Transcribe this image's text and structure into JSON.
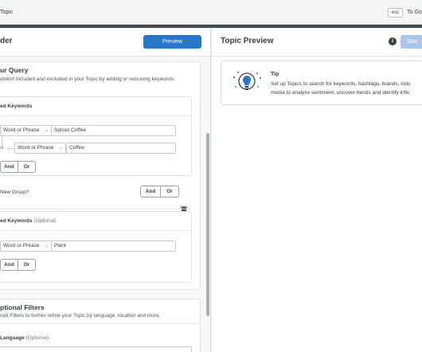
{
  "topbar": {
    "title": "Topic",
    "esc_label": "esc",
    "esc_text": "To Go"
  },
  "builder": {
    "title": "der",
    "preview_button": "Preview",
    "query": {
      "title": "ur Query",
      "description": "ontent included and excluded in your Topic by adding or removing keywords.",
      "included": {
        "label": "ed Keywords",
        "row1_type": "Word or Phrase",
        "row1_value": "Sprout Coffee",
        "row2_connector": "ot",
        "row2_type": "Word or Phrase",
        "row2_value": "Coffee",
        "and_label": "And",
        "or_label": "Or"
      },
      "new_group": {
        "label": "New Group?",
        "and_label": "And",
        "or_label": "Or"
      },
      "excluded": {
        "label": "ed Keywords",
        "optional": "(Optional)",
        "row1_type": "Word or Phrase",
        "row1_value": "Plant",
        "and_label": "And",
        "or_label": "Or"
      }
    },
    "filters": {
      "title": "ptional Filters",
      "description": "ced Filters to further refine your Topic by language, location and more.",
      "language_label": "Language",
      "language_optional": "(Optional)"
    }
  },
  "preview": {
    "title": "Topic Preview",
    "start_button": "Star",
    "tip": {
      "title": "Tip",
      "line1": "Set up Topics to search for keywords, hashtags, brands, indu",
      "line2": "media to analyze sentiment, uncover trends and identify influ"
    }
  },
  "icons": {
    "info": "info-icon",
    "trash": "trash-icon",
    "bulb": "lightbulb-icon",
    "chevron": "chevron-down-icon"
  },
  "colors": {
    "primary": "#2a76c9",
    "primary_disabled": "#a9c7e8",
    "text": "#364141"
  }
}
